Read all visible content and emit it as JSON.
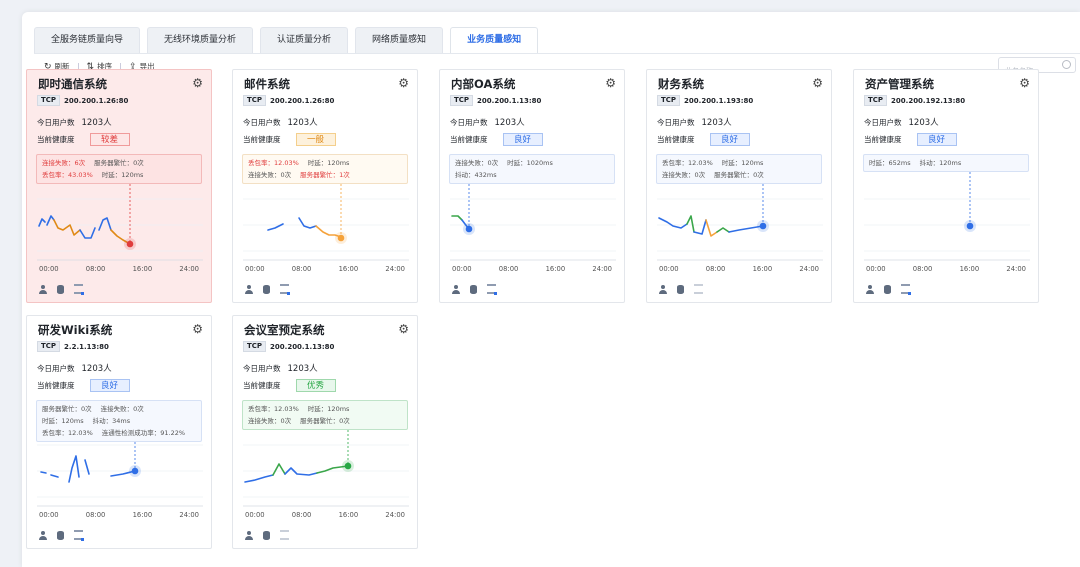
{
  "tabs": [
    "全服务链质量向导",
    "无线环境质量分析",
    "认证质量分析",
    "网络质量感知",
    "业务质量感知"
  ],
  "active_tab": 4,
  "toolbar": {
    "refresh": "刷新",
    "sort": "排序",
    "export": "导出"
  },
  "search": {
    "placeholder": "业务名称"
  },
  "labels": {
    "users": "今日用户数",
    "health": "当前健康度"
  },
  "times": [
    "00:00",
    "08:00",
    "16:00",
    "24:00"
  ],
  "colors": {
    "accent": "#2f6ee6",
    "bad": "#e03d3d",
    "mid": "#e08a16",
    "good": "#2f6ee6",
    "excellent": "#28a745",
    "line_orange": "#f5a23a",
    "line_green": "#3aa64a"
  },
  "cards": [
    {
      "title": "即时通信系统",
      "proto": "TCP",
      "addr": "200.200.1.26:80",
      "users": "1203人",
      "health": "较差",
      "status": "bad",
      "metrics": [
        [
          {
            "t": "连接失败：6次",
            "alert": true
          },
          {
            "t": "服务器繁忙：0次",
            "alert": false
          }
        ],
        [
          {
            "t": "丢包率：43.03%",
            "alert": true
          },
          {
            "t": "时延：120ms",
            "alert": false
          }
        ]
      ]
    },
    {
      "title": "邮件系统",
      "proto": "TCP",
      "addr": "200.200.1.26:80",
      "users": "1203人",
      "health": "一般",
      "status": "mid",
      "metrics": [
        [
          {
            "t": "丢包率：12.03%",
            "alert": true
          },
          {
            "t": "时延：120ms",
            "alert": false
          }
        ],
        [
          {
            "t": "连接失败：0次",
            "alert": false
          },
          {
            "t": "服务器繁忙：1次",
            "alert": true
          }
        ]
      ]
    },
    {
      "title": "内部OA系统",
      "proto": "TCP",
      "addr": "200.200.1.13:80",
      "users": "1203人",
      "health": "良好",
      "status": "good",
      "metrics": [
        [
          {
            "t": "连接失败：0次",
            "alert": false
          },
          {
            "t": "时延：1020ms",
            "alert": false
          }
        ],
        [
          {
            "t": "抖动：432ms",
            "alert": false
          }
        ]
      ]
    },
    {
      "title": "财务系统",
      "proto": "TCP",
      "addr": "200.200.1.193:80",
      "users": "1203人",
      "health": "良好",
      "status": "good",
      "metrics": [
        [
          {
            "t": "丢包率：12.03%",
            "alert": false
          },
          {
            "t": "时延：120ms",
            "alert": false
          }
        ],
        [
          {
            "t": "连接失败：0次",
            "alert": false
          },
          {
            "t": "服务器繁忙：0次",
            "alert": false
          }
        ]
      ]
    },
    {
      "title": "资产管理系统",
      "proto": "TCP",
      "addr": "200.200.192.13:80",
      "users": "1203人",
      "health": "良好",
      "status": "good",
      "metrics": [
        [
          {
            "t": "时延：652ms",
            "alert": false
          },
          {
            "t": "抖动：120ms",
            "alert": false
          }
        ]
      ]
    },
    {
      "title": "研发Wiki系统",
      "proto": "TCP",
      "addr": "2.2.1.13:80",
      "users": "1203人",
      "health": "良好",
      "status": "good",
      "metrics": [
        [
          {
            "t": "服务器繁忙：0次",
            "alert": false
          },
          {
            "t": "连接失败：0次",
            "alert": false
          }
        ],
        [
          {
            "t": "时延：120ms",
            "alert": false
          },
          {
            "t": "抖动：34ms",
            "alert": false
          }
        ],
        [
          {
            "t": "丢包率：12.03%",
            "alert": false
          },
          {
            "t": "连通性检测成功率：91.22%",
            "alert": false
          }
        ]
      ]
    },
    {
      "title": "会议室预定系统",
      "proto": "TCP",
      "addr": "200.200.1.13:80",
      "users": "1203人",
      "health": "优秀",
      "status": "ex",
      "metrics": [
        [
          {
            "t": "丢包率：12.03%",
            "alert": false
          },
          {
            "t": "时延：120ms",
            "alert": false
          }
        ],
        [
          {
            "t": "连接失败：0次",
            "alert": false
          },
          {
            "t": "服务器繁忙：0次",
            "alert": false
          }
        ]
      ]
    }
  ]
}
